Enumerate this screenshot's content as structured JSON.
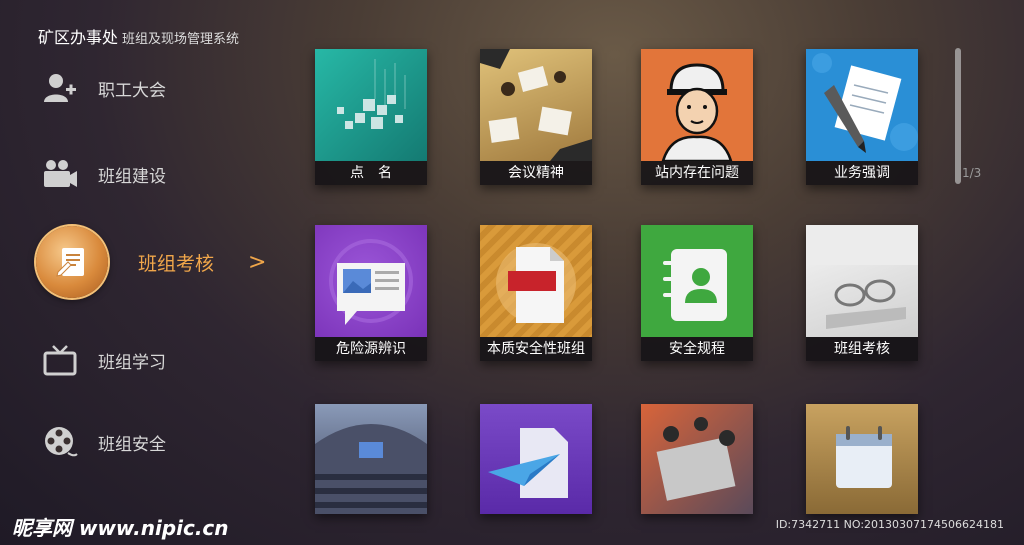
{
  "header": {
    "title": "矿区办事处",
    "subtitle": "班组及现场管理系统"
  },
  "sidebar": {
    "items": [
      {
        "label": "职工大会",
        "icon": "add-user-icon"
      },
      {
        "label": "班组建设",
        "icon": "camera-icon"
      },
      {
        "label": "班组考核",
        "icon": "document-edit-icon",
        "active": true
      },
      {
        "label": "班组学习",
        "icon": "tv-icon"
      },
      {
        "label": "班组安全",
        "icon": "film-reel-icon"
      }
    ],
    "active_arrow": ">"
  },
  "tiles": [
    {
      "label": "点　名",
      "icon": "cubes-icon",
      "color": "#1fa89a"
    },
    {
      "label": "会议精神",
      "icon": "meeting-photo-icon",
      "color": "#c9a26a"
    },
    {
      "label": "站内存在问题",
      "icon": "worker-helmet-icon",
      "color": "#e2753a"
    },
    {
      "label": "业务强调",
      "icon": "pen-paper-icon",
      "color": "#2a8fd6"
    },
    {
      "label": "危险源辨识",
      "icon": "chat-image-icon",
      "color": "#8b43c8"
    },
    {
      "label": "本质安全性班组",
      "icon": "pdf-icon",
      "color": "#d99a3a"
    },
    {
      "label": "安全规程",
      "icon": "contact-book-icon",
      "color": "#3fa83f"
    },
    {
      "label": "班组考核",
      "icon": "glasses-photo-icon",
      "color": "#e8e8e8"
    },
    {
      "label": "",
      "icon": "auditorium-photo-icon",
      "color": "#5a6a8a"
    },
    {
      "label": "",
      "icon": "paper-plane-icon",
      "color": "#6a3ab8"
    },
    {
      "label": "",
      "icon": "office-photo-icon",
      "color": "#c05a3a"
    },
    {
      "label": "",
      "icon": "calendar-icon",
      "color": "#b08a4a"
    }
  ],
  "pager": {
    "indicator": "1/3"
  },
  "watermark": {
    "left": "昵享网 www.nipic.cn",
    "right": "ID:7342711 NO:20130307174506624181"
  }
}
